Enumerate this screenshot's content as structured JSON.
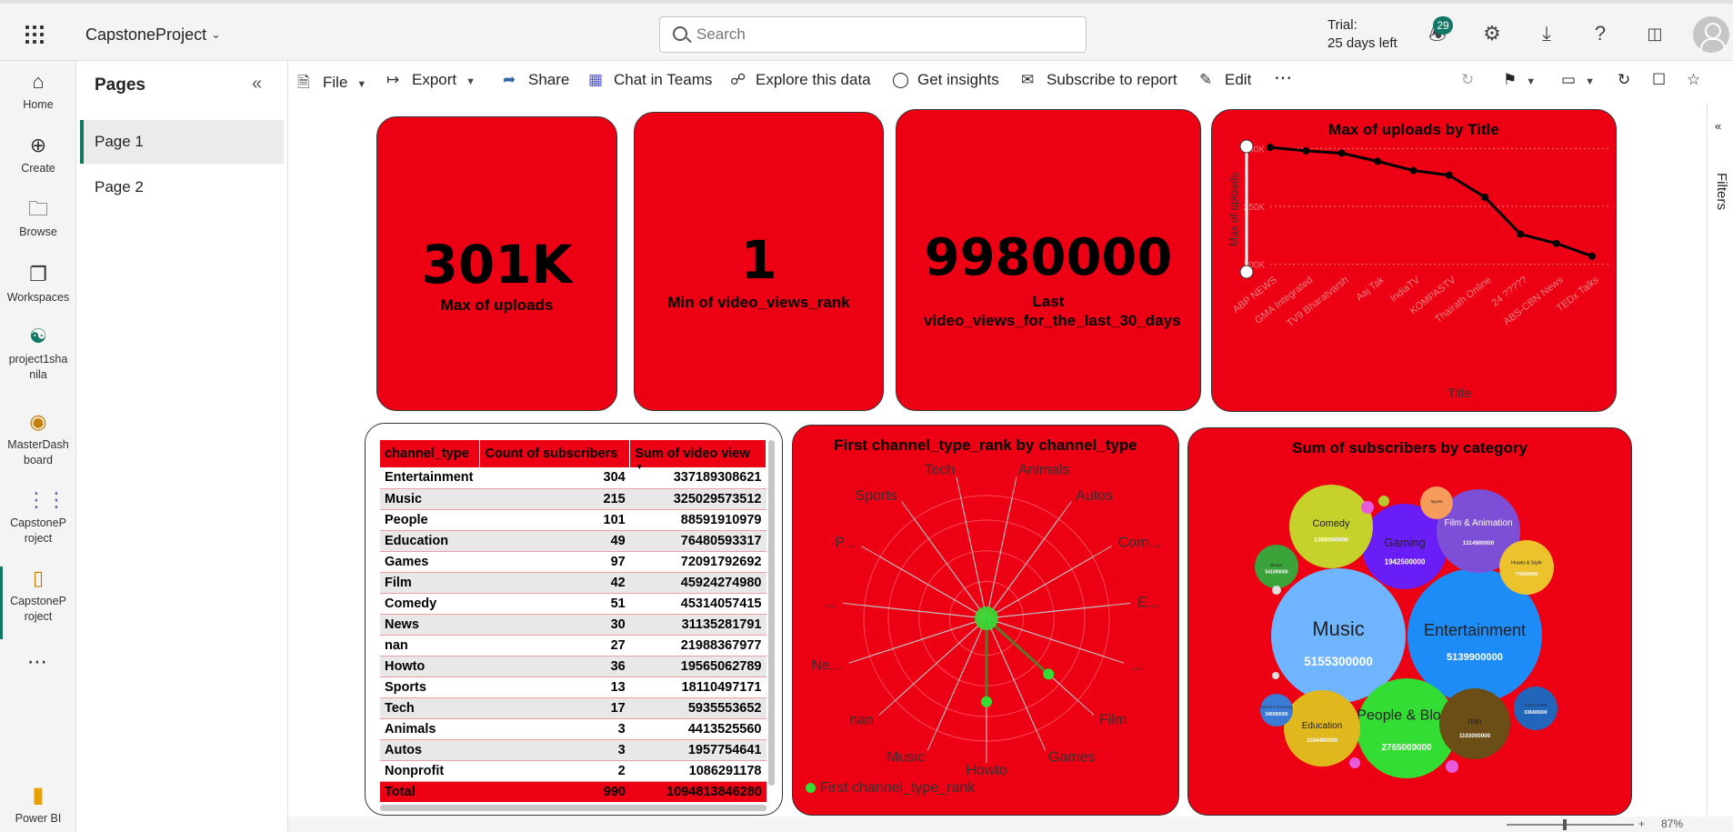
{
  "header": {
    "workspace_title": "CapstoneProject",
    "search_placeholder": "Search",
    "trial_line1": "Trial:",
    "trial_line2": "25 days left",
    "notification_count": "29"
  },
  "left_nav": [
    {
      "label": "Home",
      "icon": "home-icon"
    },
    {
      "label": "Create",
      "icon": "create-icon"
    },
    {
      "label": "Browse",
      "icon": "browse-icon"
    },
    {
      "label": "Workspaces",
      "icon": "workspaces-icon"
    },
    {
      "label": "project1shanila",
      "icon": "project-icon"
    },
    {
      "label": "MasterDashboard",
      "icon": "dashboard-icon"
    },
    {
      "label": "CapstoneProject",
      "icon": "semantic-model-icon"
    },
    {
      "label": "CapstoneProject",
      "icon": "report-icon"
    }
  ],
  "left_nav_footer": "Power BI",
  "pages_panel": {
    "title": "Pages",
    "pages": [
      "Page 1",
      "Page 2"
    ]
  },
  "toolbar": {
    "file": "File",
    "export": "Export",
    "share": "Share",
    "chat_in_teams": "Chat in Teams",
    "explore": "Explore this data",
    "insights": "Get insights",
    "subscribe": "Subscribe to report",
    "edit": "Edit"
  },
  "filters_label": "Filters",
  "zoom": "87%",
  "colors": {
    "card_red": "#ee0014",
    "accent_green": "#117865",
    "bubble_green": "#33dd33"
  },
  "kpis": [
    {
      "value": "301K",
      "label": "Max of uploads"
    },
    {
      "value": "1",
      "label": "Min of video_views_rank"
    },
    {
      "value": "9980000",
      "label": "Last video_views_for_the_last_30_days"
    }
  ],
  "table": {
    "columns": [
      "channel_type",
      "Count of subscribers",
      "Sum of video view"
    ],
    "rows": [
      [
        "Entertainment",
        "304",
        "337189308621"
      ],
      [
        "Music",
        "215",
        "325029573512"
      ],
      [
        "People",
        "101",
        "88591910979"
      ],
      [
        "Education",
        "49",
        "76480593317"
      ],
      [
        "Games",
        "97",
        "72091792692"
      ],
      [
        "Film",
        "42",
        "45924274980"
      ],
      [
        "Comedy",
        "51",
        "45314057415"
      ],
      [
        "News",
        "30",
        "31135281791"
      ],
      [
        "nan",
        "27",
        "21988367977"
      ],
      [
        "Howto",
        "36",
        "19565062789"
      ],
      [
        "Sports",
        "13",
        "18110497171"
      ],
      [
        "Tech",
        "17",
        "5935553652"
      ],
      [
        "Animals",
        "3",
        "4413525560"
      ],
      [
        "Autos",
        "3",
        "1957754641"
      ],
      [
        "Nonprofit",
        "2",
        "1086291178"
      ]
    ],
    "total": [
      "Total",
      "990",
      "1094813846280"
    ]
  },
  "chart_data": [
    {
      "type": "line",
      "title": "Max of uploads by Title",
      "xlabel": "Title",
      "ylabel": "Max of uploads",
      "x": [
        "ABP NEWS",
        "GMA Integrated",
        "TV9 Bharatvarsh",
        "Aaj Tak",
        "IndiaTV",
        "KOMPASTV",
        "Thairath Online",
        "24 ?????",
        "ABS-CBN News",
        "TEDx Talks"
      ],
      "yticks": [
        "300K",
        "250K",
        "200K"
      ],
      "ylim": [
        195000,
        305000
      ],
      "values": [
        301000,
        298000,
        296000,
        289000,
        281000,
        277000,
        258000,
        226000,
        218000,
        207000
      ],
      "color": "#000000"
    },
    {
      "type": "radar",
      "title": "First channel_type_rank by channel_type",
      "categories": [
        "Animals",
        "Autos",
        "Com...",
        "E...",
        "...",
        "Film",
        "Games",
        "Howto",
        "Music",
        "nan",
        "Ne...",
        "...",
        "P...",
        "Sports",
        "Tech"
      ],
      "values": [
        0,
        0,
        0,
        0,
        0,
        1,
        0,
        1,
        0,
        0,
        0,
        0,
        0,
        0,
        0
      ],
      "legend": "First channel_type_rank",
      "color": "#33dd33"
    },
    {
      "type": "bubble",
      "title": "Sum of subscribers by category",
      "bubbles": [
        {
          "label": "Music",
          "value": "5155300000",
          "color": "#6fb4ff"
        },
        {
          "label": "Entertainment",
          "value": "5139900000",
          "color": "#1e8cf7"
        },
        {
          "label": "People & Blogs",
          "value": "2765000000",
          "color": "#33dd33"
        },
        {
          "label": "Gaming",
          "value": "1942500000",
          "color": "#6a1ef7"
        },
        {
          "label": "Comedy",
          "value": "1388500000",
          "color": "#c7d12c"
        },
        {
          "label": "Film & Animation",
          "value": "1314900000",
          "color": "#7d4fd6"
        },
        {
          "label": "Education",
          "value": "1104400000",
          "color": "#e0b81e"
        },
        {
          "label": "nan",
          "value": "1103000000",
          "color": "#6b4e16"
        },
        {
          "label": "Howto & Style",
          "value": "775600000",
          "color": "#ecc22d"
        },
        {
          "label": "Shows",
          "value": "541000000",
          "color": "#3aa33a"
        },
        {
          "label": "Science & Technology",
          "value": "346000000",
          "color": "#3b7bd6"
        },
        {
          "label": "Travel & Events",
          "value": "538400000",
          "color": "#2266bb"
        },
        {
          "label": "Sports",
          "value": "",
          "color": "#f59c5a"
        }
      ]
    }
  ]
}
